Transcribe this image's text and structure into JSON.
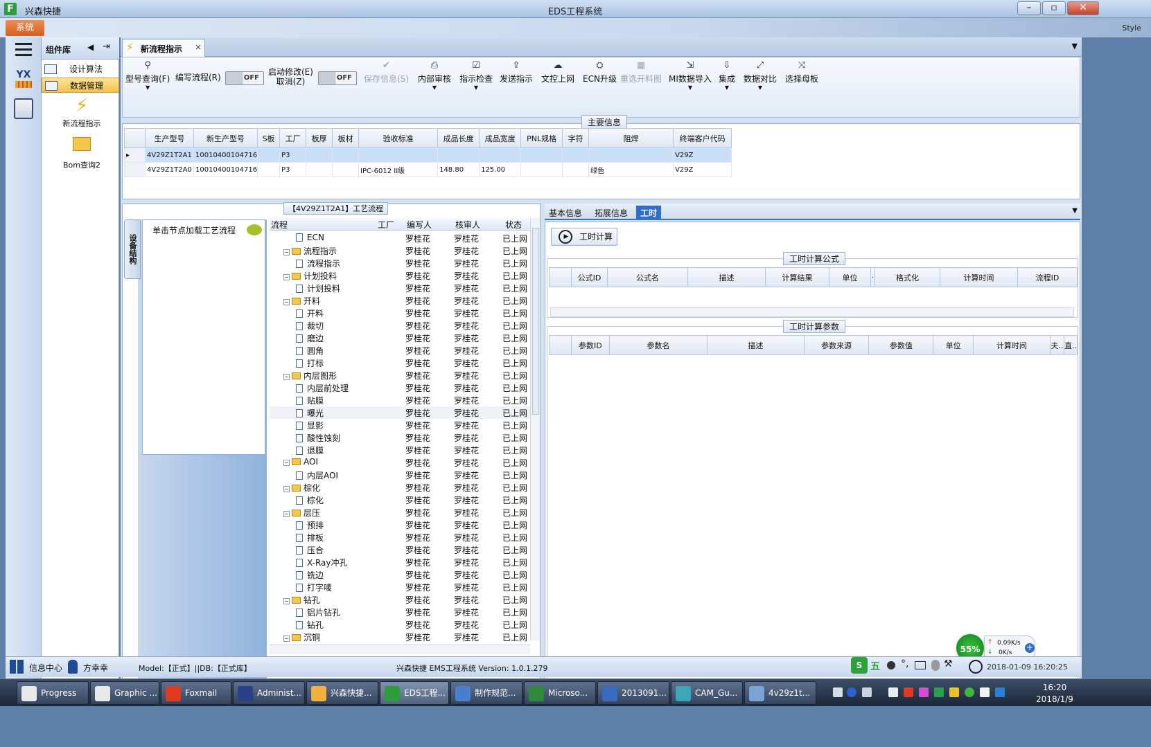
{
  "window": {
    "app_name": "兴森快捷",
    "title": "EDS工程系统",
    "system_tab": "系统",
    "style_label": "Style"
  },
  "left_panel": {
    "title": "组件库",
    "items": [
      {
        "label": "设计算法"
      },
      {
        "label": "数据管理"
      }
    ],
    "tiles": [
      {
        "label": "新流程指示"
      },
      {
        "label": "Bom查询2"
      }
    ]
  },
  "document_tab": {
    "title": "新流程指示"
  },
  "toolbar": {
    "buttons": [
      {
        "label": "型号查询(F)",
        "enabled": true
      },
      {
        "label": "编写流程(R)",
        "enabled": true
      },
      {
        "label_line1": "启动修改(E)",
        "label_line2": "取消(Z)",
        "enabled": true
      },
      {
        "label": "保存信息(S)",
        "enabled": false
      },
      {
        "label": "内部审核",
        "enabled": true
      },
      {
        "label": "指示检查",
        "enabled": true
      },
      {
        "label": "发送指示",
        "enabled": true
      },
      {
        "label": "文控上网",
        "enabled": true
      },
      {
        "label": "ECN升级",
        "enabled": true
      },
      {
        "label": "重选开料图",
        "enabled": false
      },
      {
        "label": "MI数据导入",
        "enabled": true
      },
      {
        "label": "集成",
        "enabled": true
      },
      {
        "label": "数据对比",
        "enabled": true
      },
      {
        "label": "选择母板",
        "enabled": true
      }
    ],
    "toggle_off": "OFF"
  },
  "main_info": {
    "caption": "主要信息",
    "columns": [
      "生产型号",
      "新生产型号",
      "S板",
      "工厂",
      "板厚",
      "板材",
      "验收标准",
      "成品长度",
      "成品宽度",
      "PNL规格",
      "字符",
      "阻焊",
      "终端客户代码"
    ],
    "rows": [
      [
        "4V29Z1T2A1",
        "10010400104716",
        "",
        "P3",
        "",
        "",
        "",
        "",
        "",
        "",
        "",
        "",
        "V29Z"
      ],
      [
        "4V29Z1T2A0",
        "10010400104716",
        "",
        "P3",
        "",
        "",
        "IPC-6012 II级",
        "148.80",
        "125.00",
        "",
        "",
        "绿色",
        "V29Z"
      ]
    ]
  },
  "process_panel": {
    "caption": "【4V29Z1T2A1】工艺流程",
    "vertical_tab": "设备结构",
    "hint": "单击节点加载工艺流程",
    "columns": [
      "流程",
      "工厂",
      "编写人",
      "核审人",
      "状态"
    ],
    "author": "罗桂花",
    "reviewer": "罗桂花",
    "status": "已上网",
    "nodes": [
      {
        "label": "ECN",
        "level": 1
      },
      {
        "label": "流程指示",
        "level": 0
      },
      {
        "label": "流程指示",
        "level": 1
      },
      {
        "label": "计划投料",
        "level": 0
      },
      {
        "label": "计划投料",
        "level": 1
      },
      {
        "label": "开料",
        "level": 0
      },
      {
        "label": "开料",
        "level": 1
      },
      {
        "label": "裁切",
        "level": 1
      },
      {
        "label": "磨边",
        "level": 1
      },
      {
        "label": "圆角",
        "level": 1
      },
      {
        "label": "打标",
        "level": 1
      },
      {
        "label": "内层图形",
        "level": 0
      },
      {
        "label": "内层前处理",
        "level": 1
      },
      {
        "label": "贴膜",
        "level": 1
      },
      {
        "label": "曝光",
        "level": 1
      },
      {
        "label": "显影",
        "level": 1
      },
      {
        "label": "酸性蚀刻",
        "level": 1
      },
      {
        "label": "退膜",
        "level": 1
      },
      {
        "label": "AOI",
        "level": 0
      },
      {
        "label": "内层AOI",
        "level": 1
      },
      {
        "label": "棕化",
        "level": 0
      },
      {
        "label": "棕化",
        "level": 1
      },
      {
        "label": "层压",
        "level": 0
      },
      {
        "label": "预排",
        "level": 1
      },
      {
        "label": "排板",
        "level": 1
      },
      {
        "label": "压合",
        "level": 1
      },
      {
        "label": "X-Ray冲孔",
        "level": 1
      },
      {
        "label": "铣边",
        "level": 1
      },
      {
        "label": "打字唛",
        "level": 1
      },
      {
        "label": "钻孔",
        "level": 0
      },
      {
        "label": "铝片钻孔",
        "level": 1
      },
      {
        "label": "钻孔",
        "level": 1
      },
      {
        "label": "沉铜",
        "level": 0
      }
    ]
  },
  "right_panel": {
    "tabs": [
      "基本信息",
      "拓展信息",
      "工时"
    ],
    "calc_button": "工时计算",
    "formula_caption": "工时计算公式",
    "formula_columns": [
      "公式ID",
      "公式名",
      "描述",
      "计算结果",
      "单位",
      "·",
      "格式化",
      "计算时间",
      "流程ID"
    ],
    "param_caption": "工时计算参数",
    "param_columns": [
      "参数ID",
      "参数名",
      "描述",
      "参数来源",
      "参数值",
      "单位",
      "计算时间",
      "夫..",
      "直.."
    ]
  },
  "status_bar": {
    "message_center": "信息中心",
    "user": "方幸幸",
    "model_db": "Model:【正式】||DB:【正式库】",
    "version": "兴森快捷 EMS工程系统 Version: 1.0.1.279",
    "datetime": "2018-01-09 16:20:25",
    "ime_wu": "五"
  },
  "net_meter": {
    "percent": "55%",
    "up": "0.09K/s",
    "down": "0K/s"
  },
  "taskbar": {
    "tasks": [
      "Progress",
      "Graphic ...",
      "Foxmail",
      "Administ...",
      "兴森快捷...",
      "EDS工程...",
      "制作规范...",
      "Microso...",
      "2013091...",
      "CAM_Gu...",
      "4v29z1t..."
    ],
    "time": "16:20",
    "date": "2018/1/9"
  }
}
